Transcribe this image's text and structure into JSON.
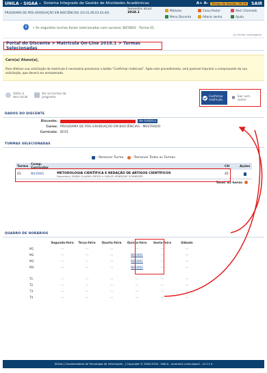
{
  "topbar": {
    "brand": "UNILA - SIGAA -",
    "system": "Sistema Integrado de Gestão de Atividades Acadêmicas",
    "font_adjust": "A+ A-",
    "session": "Tempo de Sessão: 59:29",
    "logout": "SAIR"
  },
  "subbar": {
    "course": "PROGRAMA DE PÓS-GRADUAÇÃO EM BIOCIÊNCIAS (10.01.06.03.04.00)",
    "semester_label": "Semestre atual:",
    "semester_value": "2018.1",
    "quick_links": [
      {
        "label": "Módulos",
        "color": "#e0a020"
      },
      {
        "label": "Caixa Postal",
        "color": "#e26a2c"
      },
      {
        "label": "Abrir Chamado",
        "color": "#d44"
      },
      {
        "label": "Menu Discente",
        "color": "#2a8a3a"
      },
      {
        "label": "Alterar senha",
        "color": "#d8a020"
      },
      {
        "label": "Ajuda",
        "color": "#3a7a3a"
      }
    ]
  },
  "message": {
    "icon": "info-icon",
    "text": "• As seguintes turmas foram selecionadas com sucesso: BIC0001 - Turma 01.",
    "hide_label": "(x) fechar mensagens"
  },
  "breadcrumb": "Portal do Discente > Matrícula On-Line 2018.1 > Turmas Selecionadas",
  "notice": {
    "greeting": "Caro(a) Aluno(a),",
    "body": "Para efetivar sua solicitação de matrícula é necessário pressionar o botão \"Confirmar matrícula\". Após este procedimento, será possível imprimir o comprovante da sua solicitação, que deverá ser armazenado."
  },
  "actions": {
    "back_home": [
      "Voltar à",
      "tela inicial"
    ],
    "view_program": [
      "Ver as turmas do",
      "programa"
    ],
    "confirm": [
      "Confirmar",
      "matrícula"
    ],
    "exit": [
      "Sair sem",
      "salvar"
    ]
  },
  "discente": {
    "section_title": "Dados do Discente",
    "discente_label": "Discente:",
    "history_button": "Ver histórico",
    "curso_label": "Curso:",
    "curso_value": "PROGRAMA DE PÓS-GRADUAÇÃO EM BIOCIÊNCIAS - MESTRADO",
    "curriculo_label": "Currículo:",
    "curriculo_value": "BC01"
  },
  "turmas": {
    "section_title": "Turmas Selecionadas",
    "remove_turma": ": Remover Turma",
    "remove_all": ": Remover Todas as Turmas",
    "headers": [
      "Turma",
      "Comp. Curricular",
      "",
      "CH",
      "Ações"
    ],
    "rows": [
      {
        "turma": "01",
        "code": "BIC0001",
        "title": "METODOLOGIA CIENTÍFICA E REDAÇÃO DE ARTIGOS CIENTÍFICOS",
        "prof": "Docente(s): MARIA CLAUDIA GROSS e CARLOS HENRIQUE SCHNEIDER",
        "ch": "45"
      }
    ],
    "total": "Total: 45 horas"
  },
  "schedule": {
    "section_title": "Quadro de horários",
    "days": [
      "Segunda-feira",
      "Terça-feira",
      "Quarta-feira",
      "Quinta-feira",
      "Sexta-feira",
      "Sábado"
    ],
    "morning": [
      {
        "hora": "M1",
        "cells": [
          "---",
          "---",
          "---",
          "---",
          "---",
          "---"
        ]
      },
      {
        "hora": "M2",
        "cells": [
          "---",
          "---",
          "---",
          "BIC0001",
          "---",
          "---"
        ]
      },
      {
        "hora": "M3",
        "cells": [
          "---",
          "---",
          "---",
          "BIC0001",
          "---",
          "---"
        ]
      },
      {
        "hora": "M4",
        "cells": [
          "---",
          "---",
          "---",
          "BIC0001",
          "---",
          "---"
        ]
      }
    ],
    "afternoon": [
      {
        "hora": "T1",
        "cells": [
          "---",
          "---",
          "---",
          "---",
          "---",
          "---"
        ]
      },
      {
        "hora": "T2",
        "cells": [
          "---",
          "---",
          "---",
          "---",
          "---",
          "---"
        ]
      },
      {
        "hora": "T3",
        "cells": [
          "---",
          "---",
          "---",
          "---",
          "---",
          "---"
        ]
      },
      {
        "hora": "T4",
        "cells": [
          "---",
          "---",
          "---",
          "---",
          "---",
          "---"
        ]
      }
    ]
  },
  "footer": "SIGAA | Coordenadoria de Tecnologia da Informação - | Copyright © 2006-2018 - UNILA - amarelo2.unila.sigaa2 - v3.11.9",
  "colors": {
    "navy": "#0a3f6e",
    "link": "#1f4d8f",
    "highlight": "#e21b1b",
    "notice_bg": "#fefbd6"
  }
}
